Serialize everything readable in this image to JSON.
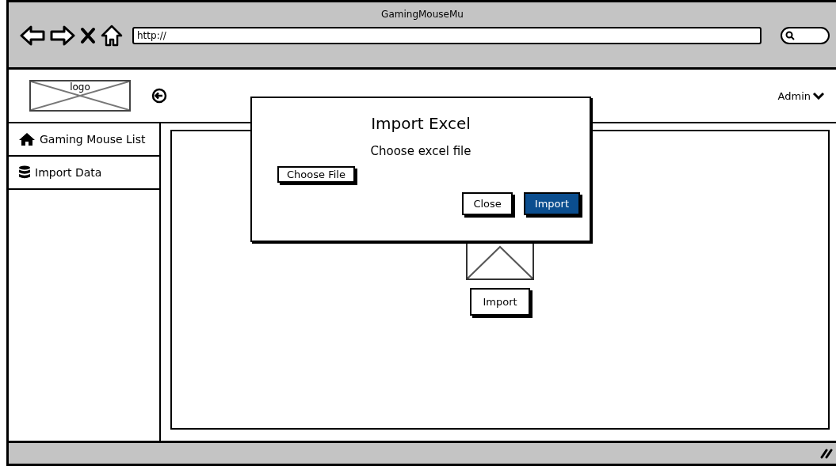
{
  "window": {
    "title": "GamingMouseMu"
  },
  "address_bar": {
    "value": "http://"
  },
  "header": {
    "logo": "logo",
    "user_menu": "Admin"
  },
  "sidebar": {
    "items": [
      {
        "label": "Gaming Mouse List",
        "kind": "home"
      },
      {
        "label": "Import Data",
        "kind": "database"
      }
    ]
  },
  "main": {
    "button": "Import"
  },
  "dialog": {
    "title": "Import Excel",
    "prompt": "Choose excel file",
    "file_button": "Choose File",
    "buttons": [
      {
        "label": "Close",
        "kind": "secondary"
      },
      {
        "label": "Import",
        "kind": "primary"
      }
    ]
  }
}
